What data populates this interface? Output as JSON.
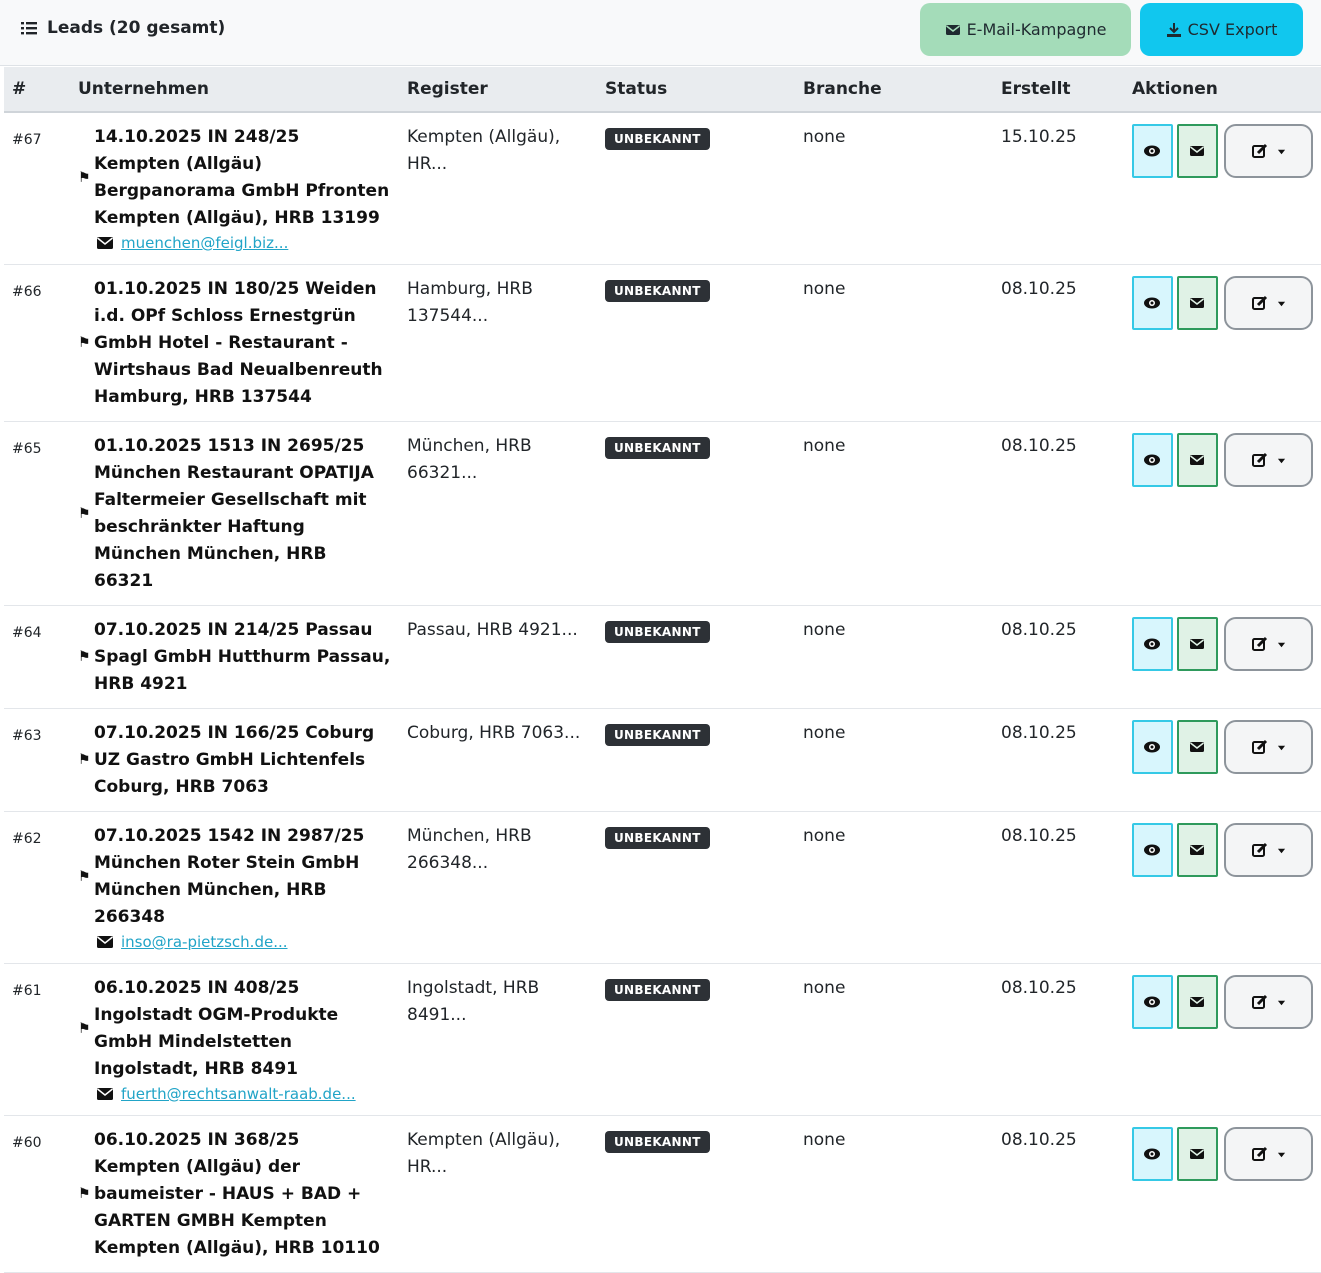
{
  "header": {
    "title": "Leads (20 gesamt)",
    "mail_campaign_label": "E-Mail-Kampagne",
    "csv_export_label": "CSV Export"
  },
  "table": {
    "columns": [
      "#",
      "Unternehmen",
      "Register",
      "Status",
      "Branche",
      "Erstellt",
      "Aktionen"
    ],
    "rows": [
      {
        "num": "#67",
        "company": "14.10.2025 IN 248/25 Kempten (Allgäu) Bergpanorama GmbH Pfronten Kempten (Allgäu), HRB 13199",
        "email": "muenchen@feigl.biz...",
        "register": "Kempten (Allgäu), HR...",
        "status": "UNBEKANNT",
        "branche": "none",
        "created": "15.10.25"
      },
      {
        "num": "#66",
        "company": "01.10.2025 IN 180/25 Weiden i.d. OPf Schloss Ernestgrün GmbH Hotel - Restaurant - Wirtshaus Bad Neualbenreuth Hamburg, HRB 137544",
        "email": "",
        "register": "Hamburg, HRB 137544...",
        "status": "UNBEKANNT",
        "branche": "none",
        "created": "08.10.25"
      },
      {
        "num": "#65",
        "company": "01.10.2025 1513 IN 2695/25 München Restaurant OPATIJA Faltermeier Gesellschaft mit beschränkter Haftung München München, HRB 66321",
        "email": "",
        "register": "München, HRB 66321...",
        "status": "UNBEKANNT",
        "branche": "none",
        "created": "08.10.25"
      },
      {
        "num": "#64",
        "company": "07.10.2025 IN 214/25 Passau Spagl GmbH Hutthurm Passau, HRB 4921",
        "email": "",
        "register": "Passau, HRB 4921...",
        "status": "UNBEKANNT",
        "branche": "none",
        "created": "08.10.25"
      },
      {
        "num": "#63",
        "company": "07.10.2025 IN 166/25 Coburg UZ Gastro GmbH Lichtenfels Coburg, HRB 7063",
        "email": "",
        "register": "Coburg, HRB 7063...",
        "status": "UNBEKANNT",
        "branche": "none",
        "created": "08.10.25"
      },
      {
        "num": "#62",
        "company": "07.10.2025 1542 IN 2987/25 München Roter Stein GmbH München München, HRB 266348",
        "email": "inso@ra-pietzsch.de...",
        "register": "München, HRB 266348...",
        "status": "UNBEKANNT",
        "branche": "none",
        "created": "08.10.25"
      },
      {
        "num": "#61",
        "company": "06.10.2025 IN 408/25 Ingolstadt OGM-Produkte GmbH Mindelstetten Ingolstadt, HRB 8491",
        "email": "fuerth@rechtsanwalt-raab.de...",
        "register": "Ingolstadt, HRB 8491...",
        "status": "UNBEKANNT",
        "branche": "none",
        "created": "08.10.25"
      },
      {
        "num": "#60",
        "company": "06.10.2025 IN 368/25 Kempten (Allgäu) der baumeister - HAUS + BAD + GARTEN GMBH Kempten Kempten (Allgäu), HRB 10110",
        "email": "",
        "register": "Kempten (Allgäu), HR...",
        "status": "UNBEKANNT",
        "branche": "none",
        "created": "08.10.25"
      }
    ]
  },
  "colors": {
    "mail_button": "#a4dcb9",
    "csv_button": "#11c7ee",
    "badge": "#2d3136",
    "link": "#21a4c7"
  }
}
